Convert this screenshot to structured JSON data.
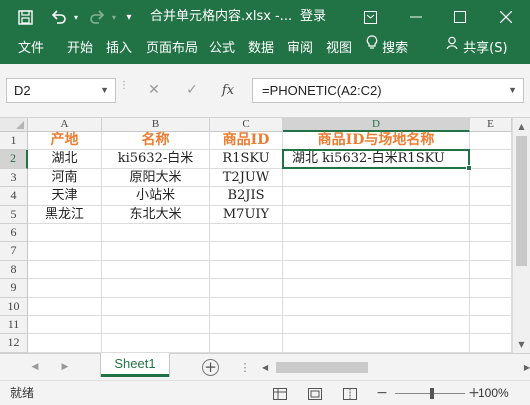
{
  "titlebar": {
    "filename": "合并单元格内容.xlsx  -...",
    "login_label": "登录"
  },
  "ribbon": {
    "tabs": [
      "文件",
      "开始",
      "插入",
      "页面布局",
      "公式",
      "数据",
      "审阅",
      "视图"
    ],
    "search_label": "搜索",
    "share_label": "共享(S)"
  },
  "formula_bar": {
    "name_box": "D2",
    "fx_label": "fx",
    "formula": "=PHONETIC(A2:C2)"
  },
  "sheet": {
    "columns": [
      "A",
      "B",
      "C",
      "D",
      "E"
    ],
    "rows": [
      "1",
      "2",
      "3",
      "4",
      "5",
      "6",
      "7",
      "8",
      "9",
      "10",
      "11",
      "12"
    ],
    "headers": [
      "产地",
      "名称",
      "商品ID",
      "商品ID与场地名称"
    ],
    "data": [
      [
        "湖北",
        "ki5632-白米",
        "R1SKU",
        "湖北 ki5632-白米R1SKU"
      ],
      [
        "河南",
        "原阳大米",
        "T2JUW",
        ""
      ],
      [
        "天津",
        "小站米",
        "B2JIS",
        ""
      ],
      [
        "黑龙江",
        "东北大米",
        "M7UIY",
        ""
      ]
    ],
    "active_cell": "D2"
  },
  "sheet_tabs": {
    "tabs": [
      "Sheet1"
    ]
  },
  "statusbar": {
    "status": "就绪",
    "zoom": "100%"
  },
  "colors": {
    "accent": "#217346",
    "header_text": "#ed7d31"
  }
}
